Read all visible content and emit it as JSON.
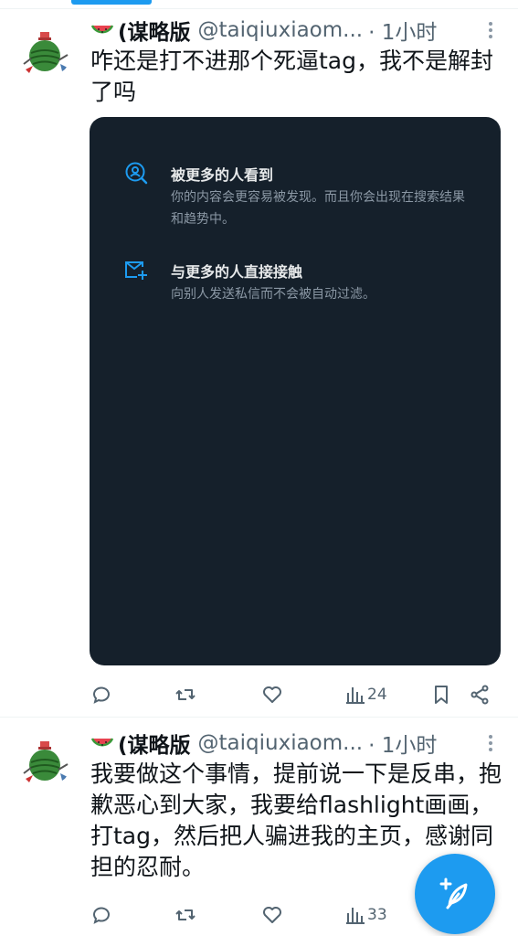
{
  "tweets": [
    {
      "name": "(谋略版",
      "handle": "@taiqiuxiaom...",
      "time": "· 1小时",
      "text": "咋还是打不进那个死逼tag，我不是解封了吗",
      "media": {
        "features": [
          {
            "icon": "user-search-icon",
            "title": "被更多的人看到",
            "desc": "你的内容会更容易被发现。而且你会出现在搜索结果和趋势中。"
          },
          {
            "icon": "mail-plus-icon",
            "title": "与更多的人直接接触",
            "desc": "向别人发送私信而不会被自动过滤。"
          }
        ]
      },
      "views": "24"
    },
    {
      "name": "(谋略版",
      "handle": "@taiqiuxiaom...",
      "time": "· 1小时",
      "text": "我要做这个事情，提前说一下是反串，抱歉恶心到大家，我要给flashlight画画，打tag，然后把人骗进我的主页，感谢同担的忍耐。",
      "views": "33"
    }
  ],
  "colors": {
    "accent": "#1d9bf0",
    "card_bg": "#15202b",
    "secondary_text": "#536471"
  }
}
